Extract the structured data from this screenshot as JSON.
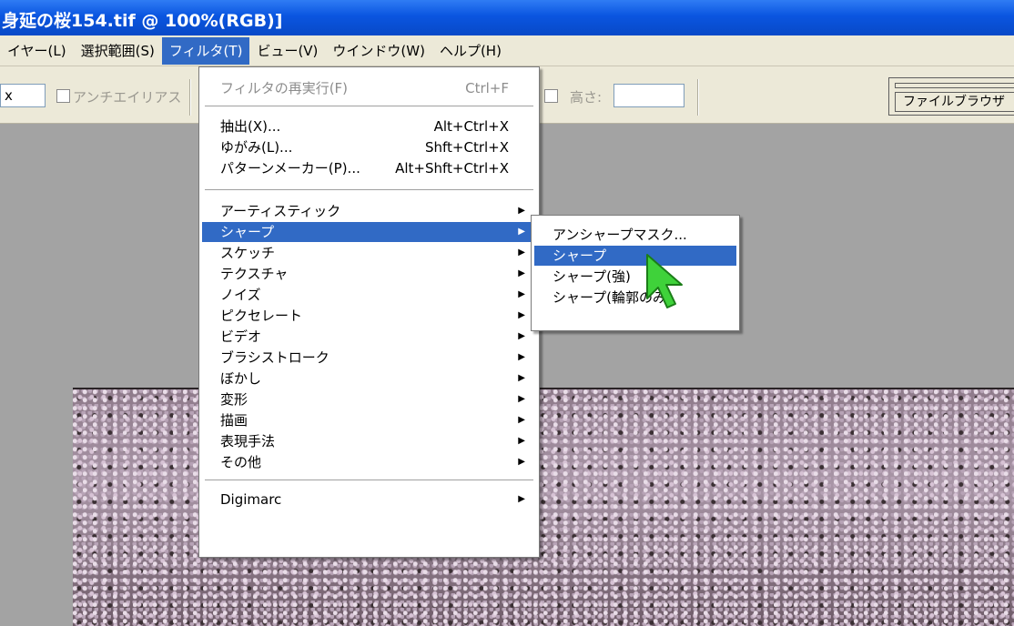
{
  "window": {
    "title": "身延の桜154.tif @ 100%(RGB)]"
  },
  "menubar": [
    {
      "label": "イヤー(L)",
      "active": false
    },
    {
      "label": "選択範囲(S)",
      "active": false
    },
    {
      "label": "フィルタ(T)",
      "active": true
    },
    {
      "label": "ビュー(V)",
      "active": false
    },
    {
      "label": "ウインドウ(W)",
      "active": false
    },
    {
      "label": "ヘルプ(H)",
      "active": false
    }
  ],
  "options": {
    "field_value": "x",
    "antialias_label": "アンチエイリアス",
    "height_label": "高さ:",
    "file_browser_tab": "ファイルブラウザ"
  },
  "filter_menu": {
    "last_filter": {
      "label": "フィルタの再実行(F)",
      "shortcut": "Ctrl+F"
    },
    "extract": {
      "label": "抽出(X)...",
      "shortcut": "Alt+Ctrl+X"
    },
    "liquify": {
      "label": "ゆがみ(L)...",
      "shortcut": "Shft+Ctrl+X"
    },
    "pattern_maker": {
      "label": "パターンメーカー(P)...",
      "shortcut": "Alt+Shft+Ctrl+X"
    },
    "artistic": "アーティスティック",
    "sharpen": "シャープ",
    "sketch": "スケッチ",
    "texture": "テクスチャ",
    "noise": "ノイズ",
    "pixelate": "ピクセレート",
    "video": "ビデオ",
    "brush_strokes": "ブラシストローク",
    "blur": "ぼかし",
    "distort": "変形",
    "render": "描画",
    "stylize": "表現手法",
    "other": "その他",
    "digimarc": "Digimarc"
  },
  "sharpen_submenu": {
    "unsharp_mask": "アンシャープマスク...",
    "sharpen": "シャープ",
    "sharpen_more": "シャープ(強)",
    "sharpen_edges": "シャープ(輪郭のみ)"
  },
  "colors": {
    "highlight": "#316ac5",
    "titlebar": "#0a55e0",
    "cursor": "#3fd23a"
  },
  "icons": {
    "submenu_arrow": "▶"
  }
}
